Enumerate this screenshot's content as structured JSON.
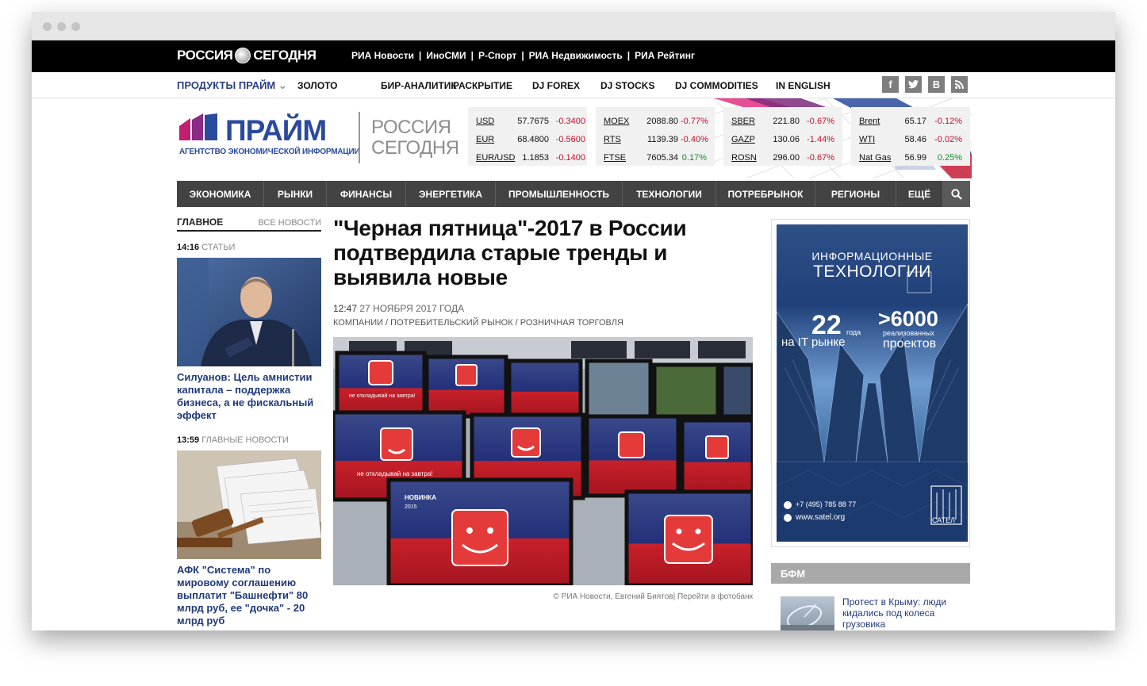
{
  "topbar": {
    "logo_left": "РОССИЯ",
    "logo_right": "СЕГОДНЯ",
    "links": [
      "РИА Новости",
      "ИноСМИ",
      "Р-Спорт",
      "РИА Недвижимость",
      "РИА Рейтинг"
    ]
  },
  "nav1": {
    "products": "ПРОДУКТЫ ПРАЙМ",
    "items": [
      "ЗОЛОТО",
      "БИР-АНАЛИТИК",
      "РАСКРЫТИЕ",
      "DJ FOREX",
      "DJ STOCKS",
      "DJ COMMODITIES",
      "IN ENGLISH"
    ],
    "social": [
      "f",
      "t",
      "B",
      "rss"
    ]
  },
  "logo": {
    "prime": "ПРАЙМ",
    "agency": "АГЕНТСТВО ЭКОНОМИЧЕСКОЙ ИНФОРМАЦИИ",
    "rs_line1": "РОССИЯ",
    "rs_line2": "СЕГОДНЯ"
  },
  "quotes": [
    [
      {
        "name": "USD",
        "value": "57.7675",
        "change": "-0.3400"
      },
      {
        "name": "EUR",
        "value": "68.4800",
        "change": "-0.5600"
      },
      {
        "name": "EUR/USD",
        "value": "1.1853",
        "change": "-0.1400"
      }
    ],
    [
      {
        "name": "MOEX",
        "value": "2088.80",
        "change": "-0.77%"
      },
      {
        "name": "RTS",
        "value": "1139.39",
        "change": "-0.40%"
      },
      {
        "name": "FTSE",
        "value": "7605.34",
        "change": "0.17%"
      }
    ],
    [
      {
        "name": "SBER",
        "value": "221.80",
        "change": "-0.67%"
      },
      {
        "name": "GAZP",
        "value": "130.06",
        "change": "-1.44%"
      },
      {
        "name": "ROSN",
        "value": "296.00",
        "change": "-0.67%"
      }
    ],
    [
      {
        "name": "Brent",
        "value": "65.17",
        "change": "-0.12%"
      },
      {
        "name": "WTI",
        "value": "58.46",
        "change": "-0.02%"
      },
      {
        "name": "Nat Gas",
        "value": "56.99",
        "change": "0.25%"
      }
    ]
  ],
  "mainnav": [
    "ЭКОНОМИКА",
    "РЫНКИ",
    "ФИНАНСЫ",
    "ЭНЕРГЕТИКА",
    "ПРОМЫШЛЕННОСТЬ",
    "ТЕХНОЛОГИИ",
    "ПОТРЕБРЫНОК",
    "РЕГИОНЫ",
    "ЕЩЁ"
  ],
  "left": {
    "tab_main": "ГЛАВНОЕ",
    "tab_all": "ВСЕ НОВОСТИ",
    "news": [
      {
        "time": "14:16",
        "category": "СТАТЬИ",
        "title": "Силуанов: Цель амнистии капитала – поддержка бизнеса, а не фискальный эффект"
      },
      {
        "time": "13:59",
        "category": "ГЛАВНЫЕ НОВОСТИ",
        "title": "АФК \"Система\" по мировому соглашению выплатит \"Башнефти\" 80 млрд руб, ее \"дочка\" - 20 млрд руб"
      }
    ]
  },
  "article": {
    "title": "\"Черная пятница\"-2017 в России подтвердила старые тренды и выявила новые",
    "time": "12:47",
    "date": "27 НОЯБРЯ 2017 ГОДА",
    "tags": "КОМПАНИИ / ПОТРЕБИТЕЛЬСКИЙ РЫНОК / РОЗНИЧНАЯ ТОРГОВЛЯ",
    "credit": "© РИА Новости, Евгений Биятов| Перейти в фотобанк",
    "screen_text": "не откладывай на завтра!",
    "novinka": "НОВИНКА",
    "novinka_year": "2015"
  },
  "ad": {
    "line1": "ИНФОРМАЦИОННЫЕ",
    "line2": "ТЕХНОЛОГИИ",
    "years": "22",
    "years_unit": "года",
    "on_market": "на IT рынке",
    "projects": ">6000",
    "projects_sub": "реализованных",
    "projects_word": "проектов",
    "phone": "+7 (495) 785 88 77",
    "site": "www.satel.org",
    "brand": "САТЕЛ"
  },
  "bfm": {
    "header": "БФМ",
    "news": "Протест в Крыму: люди кидались под колеса грузовика"
  }
}
